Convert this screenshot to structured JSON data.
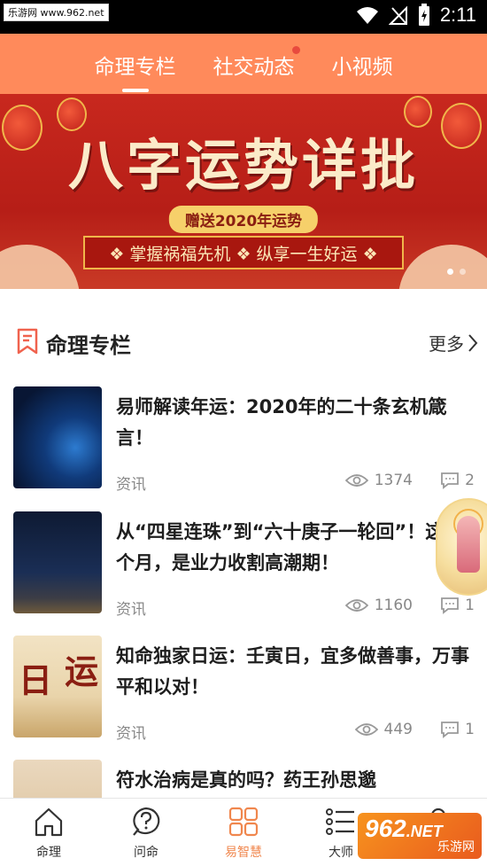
{
  "status_bar": {
    "watermark": "乐游网 www.962.net",
    "time": "2:11"
  },
  "top_tabs": [
    {
      "label": "命理专栏",
      "active": true,
      "dot": false
    },
    {
      "label": "社交动态",
      "active": false,
      "dot": true
    },
    {
      "label": "小视频",
      "active": false,
      "dot": false
    }
  ],
  "banner": {
    "title": "八字运势详批",
    "pill": "赠送2020年运势",
    "subtitle": "❖ 掌握祸福先机 ❖ 纵享一生好运 ❖",
    "slides": 2,
    "active_slide": 1
  },
  "section": {
    "title": "命理专栏",
    "more_label": "更多"
  },
  "articles": [
    {
      "title": "易师解读年运：2020年的二十条玄机箴言！",
      "category": "资讯",
      "views": "1374",
      "comments": "2"
    },
    {
      "title": "从“四星连珠”到“六十庚子一轮回”！这两个月，是业力收割高潮期！",
      "category": "资讯",
      "views": "1160",
      "comments": "1"
    },
    {
      "title": "知命独家日运：壬寅日，宜多做善事，万事平和以对！",
      "category": "资讯",
      "views": "449",
      "comments": "1"
    },
    {
      "title": "符水治病是真的吗？药王孙思邈",
      "category": "",
      "views": "",
      "comments": ""
    }
  ],
  "thumb_chars": {
    "a": "日",
    "b": "运"
  },
  "bottom_nav": [
    {
      "label": "命理",
      "icon": "house-icon",
      "active": false
    },
    {
      "label": "问命",
      "icon": "question-icon",
      "active": false
    },
    {
      "label": "易智慧",
      "icon": "grid-icon",
      "active": true
    },
    {
      "label": "大师",
      "icon": "list-icon",
      "active": false
    },
    {
      "label": "",
      "icon": "person-icon",
      "active": false
    }
  ],
  "watermark_bottom": {
    "num": "962",
    "net": ".NET",
    "sub": "乐游网"
  },
  "colors": {
    "accent": "#FF8A5B",
    "active_nav": "#F0874E",
    "banner_red": "#B61E17"
  }
}
